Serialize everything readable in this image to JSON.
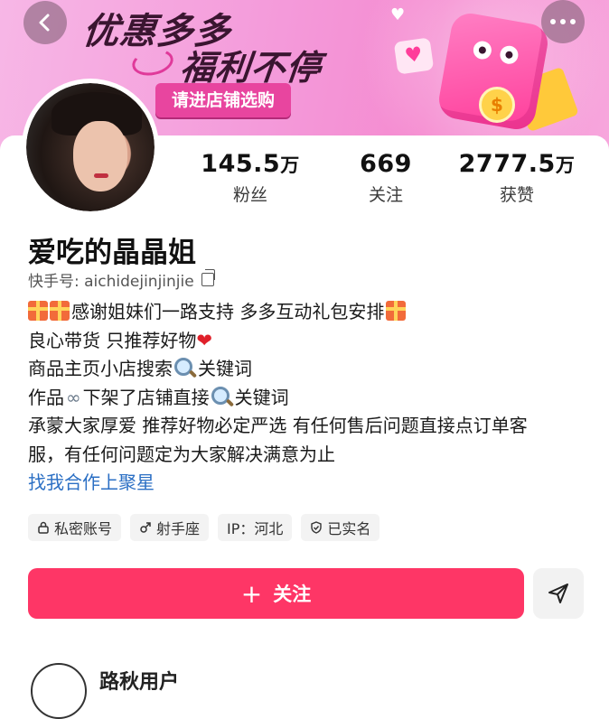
{
  "banner": {
    "line1": "优惠多多",
    "line2": "福利不停",
    "cta": "请进店铺选购",
    "coin_glyph": "$"
  },
  "profile": {
    "name": "爱吃的晶晶姐",
    "kuaishou_id": "快手号: aichidejinjinjie"
  },
  "stats": [
    {
      "num": "145.5",
      "unit": "万",
      "label": "粉丝"
    },
    {
      "num": "669",
      "unit": "",
      "label": "关注"
    },
    {
      "num": "2777.5",
      "unit": "万",
      "label": "获赞"
    }
  ],
  "bio": {
    "line1": "感谢姐妹们一路支持 多多互动礼包安排",
    "line2": "良心带货 只推荐好物",
    "line3a": "商品主页小店搜索",
    "line3b": "关键词",
    "line4a": "作品",
    "line4b": "下架了店铺直接",
    "line4c": "关键词",
    "line5": "承蒙大家厚爱 推荐好物必定严选 有任何售后问题直接点订单客",
    "line6": "服，有任何问题定为大家解决满意为止",
    "link": "找我合作上聚星"
  },
  "tags": [
    "私密账号",
    "射手座",
    "IP：河北",
    "已实名"
  ],
  "actions": {
    "follow": "关注",
    "follow_icon": "+"
  },
  "bottom": {
    "text": "路秋用户"
  },
  "colors": {
    "follow_bg": "#fe3666",
    "link": "#2b6fc4",
    "banner_pink": "#f49ada"
  }
}
